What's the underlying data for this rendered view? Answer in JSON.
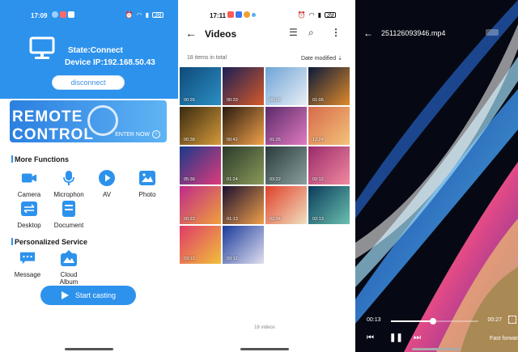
{
  "phone1": {
    "status_time": "17:09",
    "status_battery": "38",
    "state_label": "State:Connect",
    "ip_label": "Device IP:192.168.50.43",
    "disconnect_label": "disconnect",
    "remote_title": "REMOTE CONTROL",
    "enter_now": "ENTER NOW",
    "more_functions": "More Functions",
    "functions": [
      {
        "label": "Camera",
        "icon": "camera-icon"
      },
      {
        "label": "Microphon",
        "icon": "microphone-icon"
      },
      {
        "label": "AV",
        "icon": "play-icon"
      },
      {
        "label": "Photo",
        "icon": "photo-icon"
      },
      {
        "label": "Desktop",
        "icon": "desktop-icon"
      },
      {
        "label": "Document",
        "icon": "document-icon"
      }
    ],
    "personalized": "Personalized Service",
    "services": [
      {
        "label": "Message",
        "icon": "message-icon"
      },
      {
        "label": "Cloud Album",
        "icon": "cloud-album-icon"
      }
    ],
    "cast_label": "Start casting",
    "accent": "#2d92ec"
  },
  "phone2": {
    "status_time": "17:11",
    "status_battery": "39",
    "title": "Videos",
    "count_label": "18 items in total",
    "sort_label": "Date modified",
    "footer": "18 videos",
    "videos": [
      {
        "duration": "00:26",
        "c1": "#0f4a7a",
        "c2": "#2b8fc4"
      },
      {
        "duration": "00:33",
        "c1": "#1a1f55",
        "c2": "#d65a2a"
      },
      {
        "duration": "00:06",
        "c1": "#6da3d6",
        "c2": "#e9eef5"
      },
      {
        "duration": "01:06",
        "c1": "#0a1a3a",
        "c2": "#e08a2a"
      },
      {
        "duration": "00:38",
        "c1": "#3a2a10",
        "c2": "#d49a3a"
      },
      {
        "duration": "00:42",
        "c1": "#2a1a10",
        "c2": "#f0a24a"
      },
      {
        "duration": "01:26",
        "c1": "#5a2a6a",
        "c2": "#e07ac0"
      },
      {
        "duration": "12:24",
        "c1": "#d86a4a",
        "c2": "#f3c27a"
      },
      {
        "duration": "05:36",
        "c1": "#1a3a8a",
        "c2": "#e03a7a"
      },
      {
        "duration": "01:24",
        "c1": "#2a3a2a",
        "c2": "#8a9a5a"
      },
      {
        "duration": "03:22",
        "c1": "#2a3a3a",
        "c2": "#8aa0a0"
      },
      {
        "duration": "02:12",
        "c1": "#9a2a6a",
        "c2": "#f08aa0"
      },
      {
        "duration": "00:22",
        "c1": "#c02a8a",
        "c2": "#f0a03a"
      },
      {
        "duration": "01:13",
        "c1": "#1a1030",
        "c2": "#f0a04a"
      },
      {
        "duration": "02:34",
        "c1": "#e0402a",
        "c2": "#f0e0c0"
      },
      {
        "duration": "02:13",
        "c1": "#0a3a5a",
        "c2": "#6ac0b0"
      },
      {
        "duration": "03:12",
        "c1": "#e03a6a",
        "c2": "#f0c03a"
      },
      {
        "duration": "03:12",
        "c1": "#1a3a9a",
        "c2": "#e0e0f0"
      }
    ]
  },
  "phone3": {
    "file_name": "251126093946.mp4",
    "current_time": "00:13",
    "total_time": "00:27",
    "progress": 0.48,
    "fast_forward": "Fast forwar"
  }
}
